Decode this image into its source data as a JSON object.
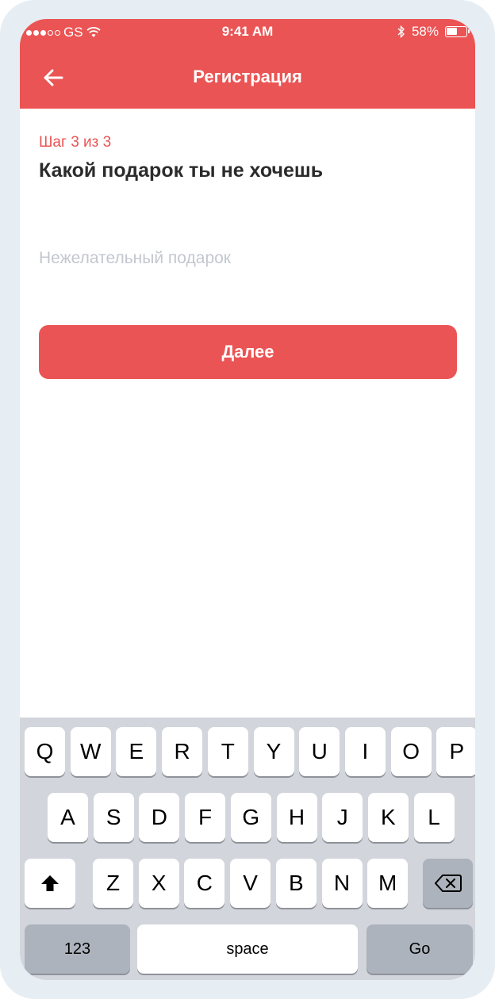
{
  "status_bar": {
    "carrier": "GS",
    "time": "9:41 AM",
    "battery": "58%",
    "battery_level": 0.58
  },
  "header": {
    "title": "Регистрация",
    "back_icon": "arrow-left-icon"
  },
  "form": {
    "step": "Шаг 3 из 3",
    "heading": "Какой подарок ты не хочешь",
    "input_placeholder": "Нежелательный подарок",
    "input_value": "",
    "next_label": "Далее"
  },
  "keyboard": {
    "row1": [
      "Q",
      "W",
      "E",
      "R",
      "T",
      "Y",
      "U",
      "I",
      "O",
      "P"
    ],
    "row2": [
      "A",
      "S",
      "D",
      "F",
      "G",
      "H",
      "J",
      "K",
      "L"
    ],
    "row3": [
      "Z",
      "X",
      "C",
      "V",
      "B",
      "N",
      "M"
    ],
    "numbers_label": "123",
    "space_label": "space",
    "go_label": "Go",
    "shift_icon": "shift-icon",
    "delete_icon": "backspace-icon"
  },
  "colors": {
    "accent": "#eb5454",
    "keyboard_bg": "#d2d5db"
  }
}
